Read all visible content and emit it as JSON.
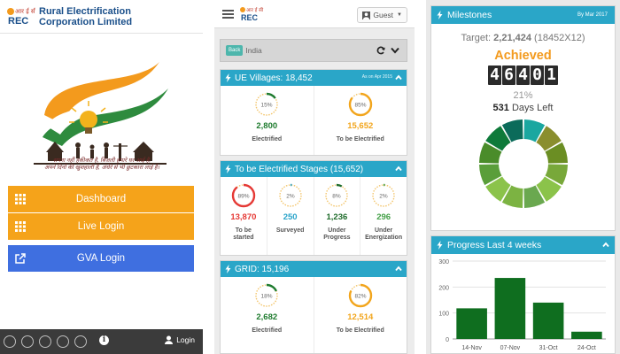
{
  "panel1": {
    "app_title_line1": "Rural Electrification",
    "app_title_line2": "Corporation Limited",
    "logo_text": "REC",
    "logo_hindi": "आर ई सी",
    "tagline_line1": "सपना नहीं हकीकत है, बिजली हमारे घर आई है,",
    "tagline_line2": "अपने दिनों की खुशहाली है, अंधेरे से भी छुटकारा लाई है।",
    "menu": [
      {
        "label": "Dashboard",
        "color": "#f5a31a"
      },
      {
        "label": "Live Login",
        "color": "#f5a31a"
      },
      {
        "label": "GVA Login",
        "color": "#3f6fe0"
      }
    ],
    "footer_login": "Login",
    "info_glyph": "i"
  },
  "panel2": {
    "logo_text": "REC",
    "logo_hindi": "आर ई सी",
    "guest_label": "Guest",
    "back_label": "Back",
    "location": "India",
    "ue_villages": {
      "title": "UE Villages: 18,452",
      "as_of": "As on Apr 2015",
      "stats": [
        {
          "pct": 15,
          "pct_label": "15%",
          "value": "2,800",
          "label": "Electrified",
          "color": "#1e7b2e"
        },
        {
          "pct": 85,
          "pct_label": "85%",
          "value": "15,652",
          "label": "To be Electrified",
          "color": "#f2a51c"
        }
      ]
    },
    "stages": {
      "title": "To be Electrified Stages (15,652)",
      "stats": [
        {
          "pct": 89,
          "pct_label": "89%",
          "value": "13,870",
          "label_line1": "To be",
          "label_line2": "started",
          "color": "#e53935"
        },
        {
          "pct": 2,
          "pct_label": "2%",
          "value": "250",
          "label_line1": "Surveyed",
          "label_line2": "",
          "color": "#29a3c9"
        },
        {
          "pct": 8,
          "pct_label": "8%",
          "value": "1,236",
          "label_line1": "Under",
          "label_line2": "Progress",
          "color": "#1e6b2a"
        },
        {
          "pct": 2,
          "pct_label": "2%",
          "value": "296",
          "label_line1": "Under",
          "label_line2": "Energization",
          "color": "#43a047"
        }
      ]
    },
    "grid": {
      "title": "GRID: 15,196",
      "stats": [
        {
          "pct": 18,
          "pct_label": "18%",
          "value": "2,682",
          "label": "Electrified",
          "color": "#1e7b2e"
        },
        {
          "pct": 82,
          "pct_label": "82%",
          "value": "12,514",
          "label": "To be Electrified",
          "color": "#f2a51c"
        }
      ]
    }
  },
  "panel3": {
    "milestones_title": "Milestones",
    "by_date": "By Mar 2017",
    "target_prefix": "Target: ",
    "target_value": "2,21,424",
    "target_suffix": " (18452X12)",
    "achieved_label": "Achieved",
    "counter_digits": [
      "4",
      "6",
      "4",
      "0",
      "1"
    ],
    "achieved_pct": "21%",
    "days_value": "531",
    "days_label": " Days Left",
    "donut_colors": [
      "#1aa7a0",
      "#8a8e2e",
      "#6b8e23",
      "#78a83a",
      "#8bc34a",
      "#6aa84f",
      "#7cb342",
      "#8bc34a",
      "#5a9e3a",
      "#4a8c2a",
      "#0e7a3a",
      "#0b6b5a"
    ],
    "progress_title": "Progress Last 4 weeks"
  },
  "chart_data": {
    "type": "bar",
    "title": "Progress Last 4 weeks",
    "categories": [
      "14-Nov",
      "07-Nov",
      "31-Oct",
      "24-Oct"
    ],
    "values": [
      118,
      235,
      140,
      28
    ],
    "ylim": [
      0,
      300
    ],
    "yticks": [
      0,
      100,
      200,
      300
    ],
    "grid": true,
    "color": "#0f6e1f"
  }
}
